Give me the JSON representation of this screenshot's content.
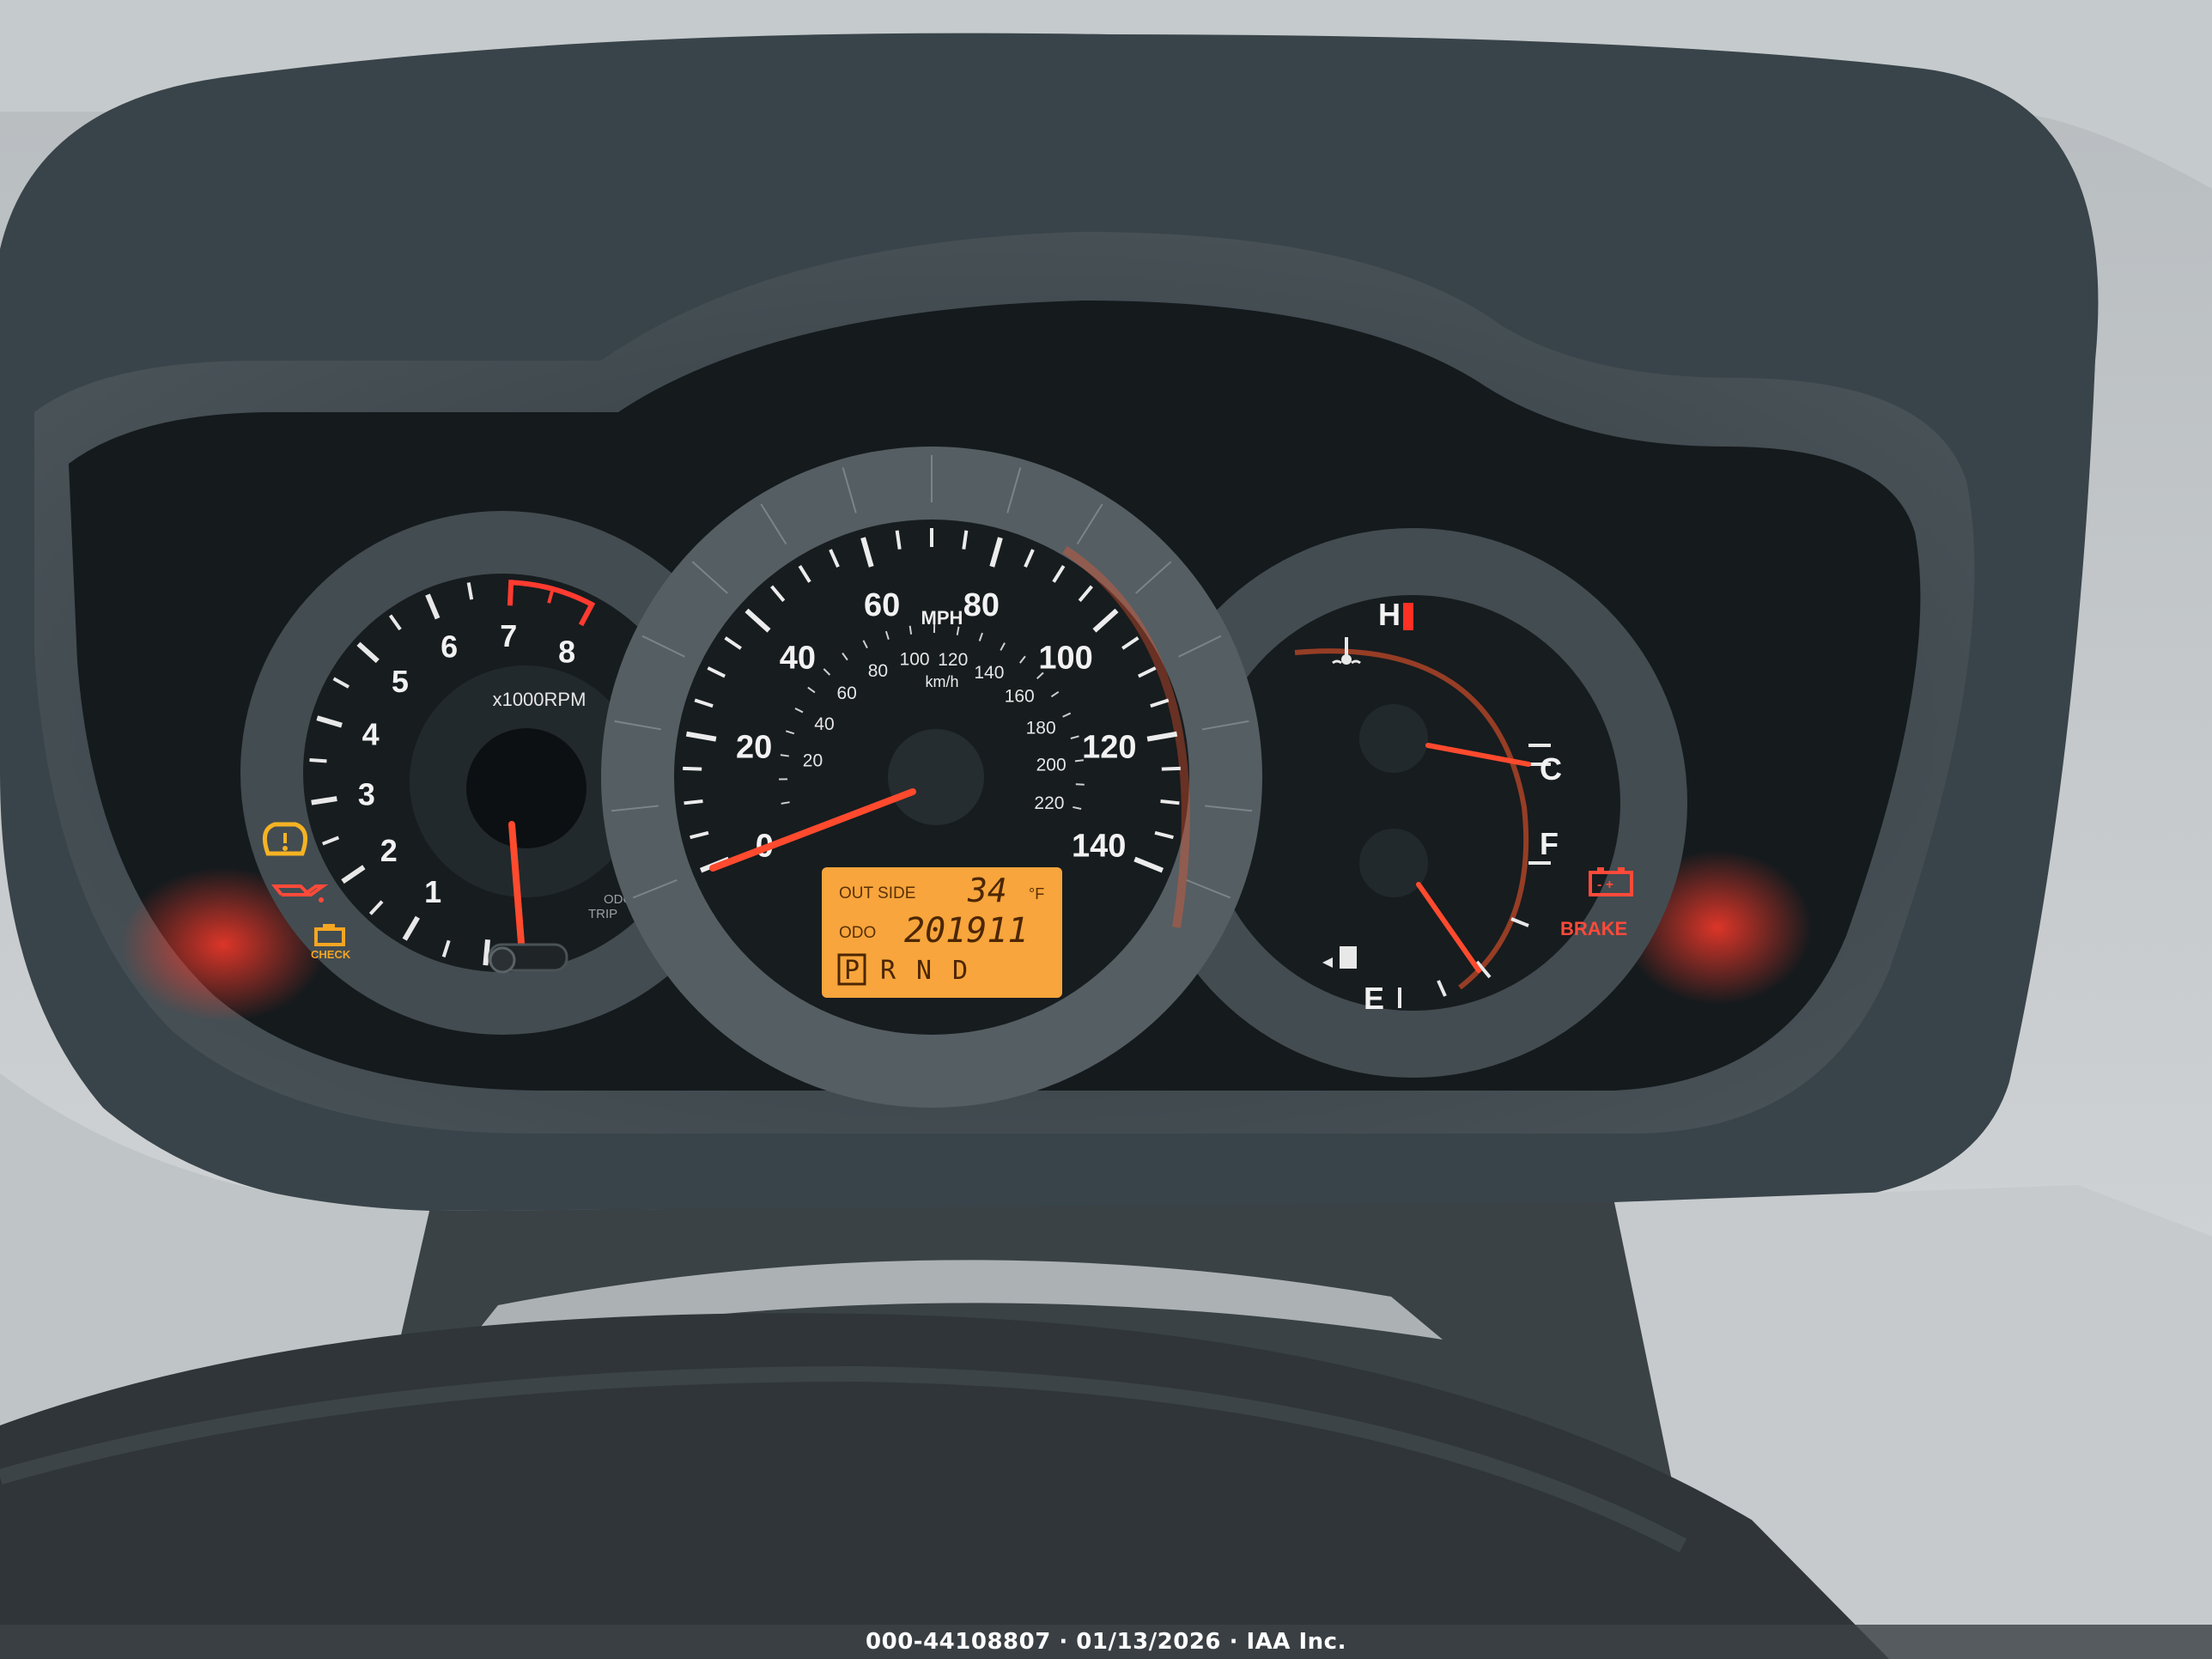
{
  "tachometer": {
    "numbers": [
      "1",
      "2",
      "3",
      "4",
      "5",
      "6",
      "7",
      "8"
    ],
    "unit": "x1000RPM",
    "odo_trip_label": [
      "ODO",
      "TRIP"
    ],
    "rpm_reading": 0
  },
  "speedometer": {
    "mph_numbers": [
      "0",
      "20",
      "40",
      "60",
      "80",
      "100",
      "120",
      "140"
    ],
    "mph_label": "MPH",
    "kmh_numbers": [
      "20",
      "40",
      "60",
      "80",
      "100",
      "120",
      "140",
      "160",
      "180",
      "200",
      "220"
    ],
    "kmh_label": "km/h",
    "speed_reading_mph": 0
  },
  "lcd": {
    "outside_label": "OUT SIDE",
    "temperature": "34",
    "temp_unit": "°F",
    "odo_label": "ODO",
    "odometer": "201911",
    "gears": [
      "P",
      "R",
      "N",
      "D"
    ],
    "selected_gear": "P"
  },
  "right_gauges": {
    "temp_hot": "H",
    "temp_cold": "C",
    "fuel_full": "F",
    "fuel_empty": "E",
    "brake_label": "BRAKE"
  },
  "warning_lights": {
    "left": [
      "tire-pressure-icon",
      "oil-pressure-icon",
      "check-engine-icon"
    ],
    "check_label": "CHECK",
    "right": [
      "battery-icon"
    ],
    "amber": "#f5a623",
    "red": "#ff4a3a"
  },
  "colors": {
    "dial_face": "#1a1f23",
    "bezel": "#4b5459",
    "needle": "#ff5a3c",
    "lcd_bg": "#f6a63a",
    "scale_text": "#f2f2f2"
  },
  "caption": "000-44108807 · 01/13/2026 · IAA Inc."
}
